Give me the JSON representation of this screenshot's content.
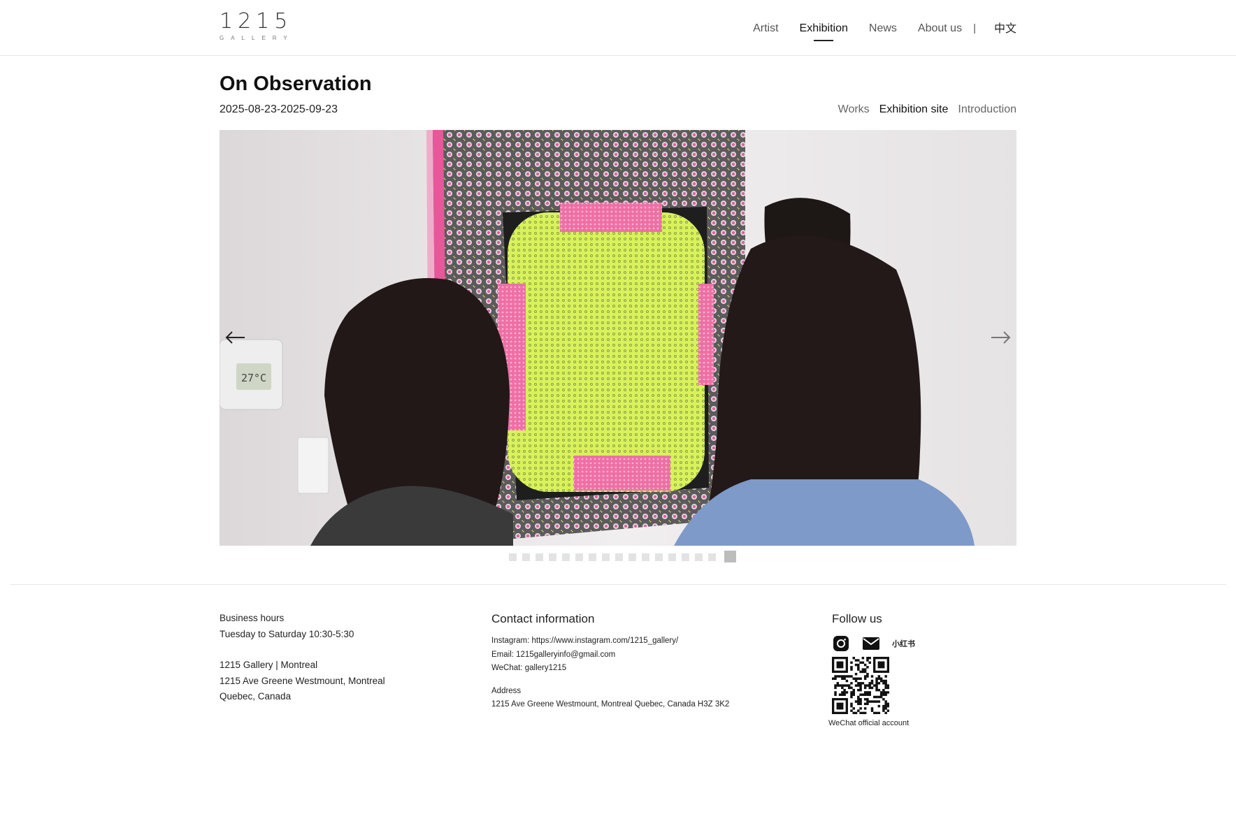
{
  "brand": {
    "logo_number": "1215",
    "logo_sub": "GALLERY"
  },
  "nav": {
    "items": [
      {
        "label": "Artist",
        "active": false
      },
      {
        "label": "Exhibition",
        "active": true
      },
      {
        "label": "News",
        "active": false
      },
      {
        "label": "About us",
        "active": false
      }
    ],
    "separator": "|",
    "language": "中文"
  },
  "exhibition": {
    "title": "On Observation",
    "dates": "2025-08-23-2025-09-23",
    "tabs": [
      {
        "label": "Works",
        "active": false
      },
      {
        "label": "Exhibition site",
        "active": true
      },
      {
        "label": "Introduction",
        "active": false
      }
    ]
  },
  "slider": {
    "thermostat_reading": "27°C",
    "total_slides": 17,
    "active_slide": 17
  },
  "footer": {
    "hours": {
      "heading": "Business hours",
      "value": "Tuesday to Saturday 10:30-5:30",
      "location": "1215 Gallery | Montreal",
      "address_line1": "1215 Ave Greene Westmount, Montreal",
      "address_line2": "Quebec, Canada"
    },
    "contact": {
      "heading": "Contact information",
      "instagram": "Instagram: https://www.instagram.com/1215_gallery/",
      "email": "Email: 1215galleryinfo@gmail.com",
      "wechat": "WeChat: gallery1215",
      "address_label": "Address",
      "address": "1215 Ave Greene Westmount, Montreal Quebec, Canada H3Z 3K2"
    },
    "follow": {
      "heading": "Follow us",
      "xiaohongshu": "小红书",
      "qr_label": "WeChat official account"
    }
  },
  "colors": {
    "accent_pink": "#e8579a",
    "lime": "#d9f25a",
    "active_dot": "#bdbdbd",
    "inactive_dot": "#e3e3e3"
  }
}
